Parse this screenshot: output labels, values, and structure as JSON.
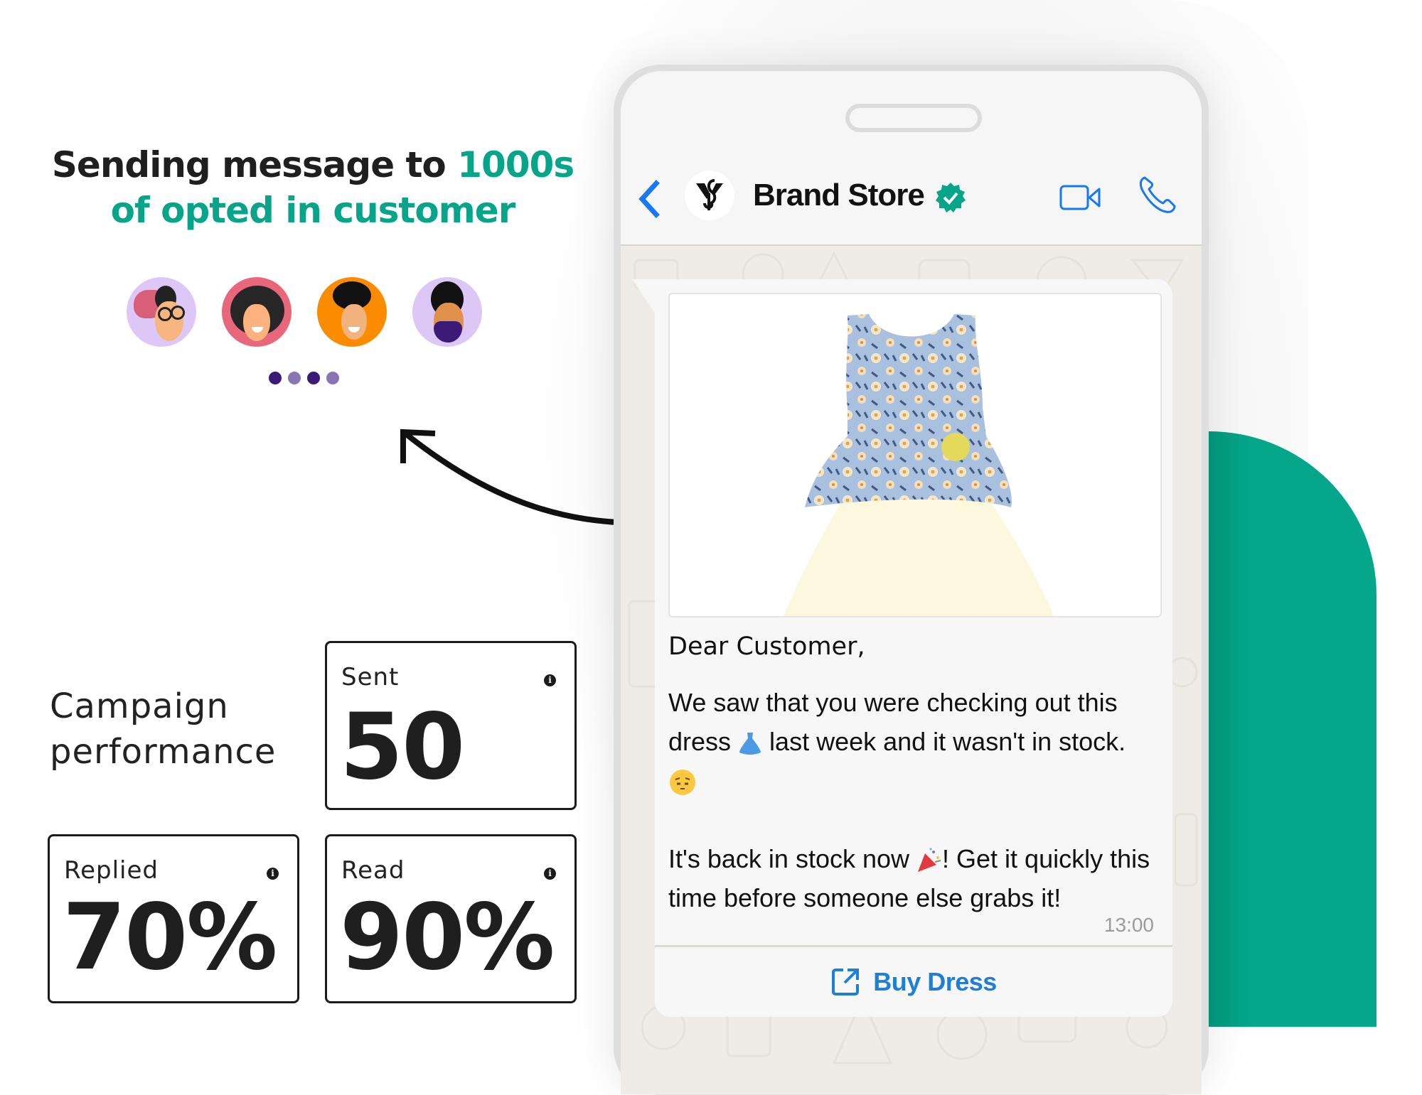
{
  "headline": {
    "part1": "Sending message to ",
    "accent1": "1000s",
    "accent2": "of opted in customer"
  },
  "avatars": [
    {
      "name": "customer-avatar-1",
      "bg": "#dcc7f7"
    },
    {
      "name": "customer-avatar-2",
      "bg": "#e8677a"
    },
    {
      "name": "customer-avatar-3",
      "bg": "#fb8c00"
    },
    {
      "name": "customer-avatar-4",
      "bg": "#dcc7f7"
    }
  ],
  "dots": [
    "#3b1a78",
    "#8a75b4",
    "#3b1a78",
    "#8a75b4"
  ],
  "campaign": {
    "title_line1": "Campaign",
    "title_line2": "performance",
    "stats": {
      "sent": {
        "label": "Sent",
        "value": "50"
      },
      "replied": {
        "label": "Replied",
        "value": "70%"
      },
      "read": {
        "label": "Read",
        "value": "90%"
      }
    },
    "info_glyph": "i"
  },
  "chat": {
    "contact_name": "Brand Store",
    "verified": true,
    "message": {
      "greeting": "Dear Customer,",
      "para1_a": "We saw that you were checking out this dress ",
      "para1_b": " last week and it wasn't in stock.",
      "para2_a": "It's back in stock now ",
      "para2_b": "! Get it quickly this time before someone else grabs it!",
      "time": "13:00"
    },
    "button_label": "Buy Dress"
  },
  "colors": {
    "accent_green": "#06a58a",
    "link_blue": "#1e7fd6",
    "ios_blue": "#1877f2"
  }
}
